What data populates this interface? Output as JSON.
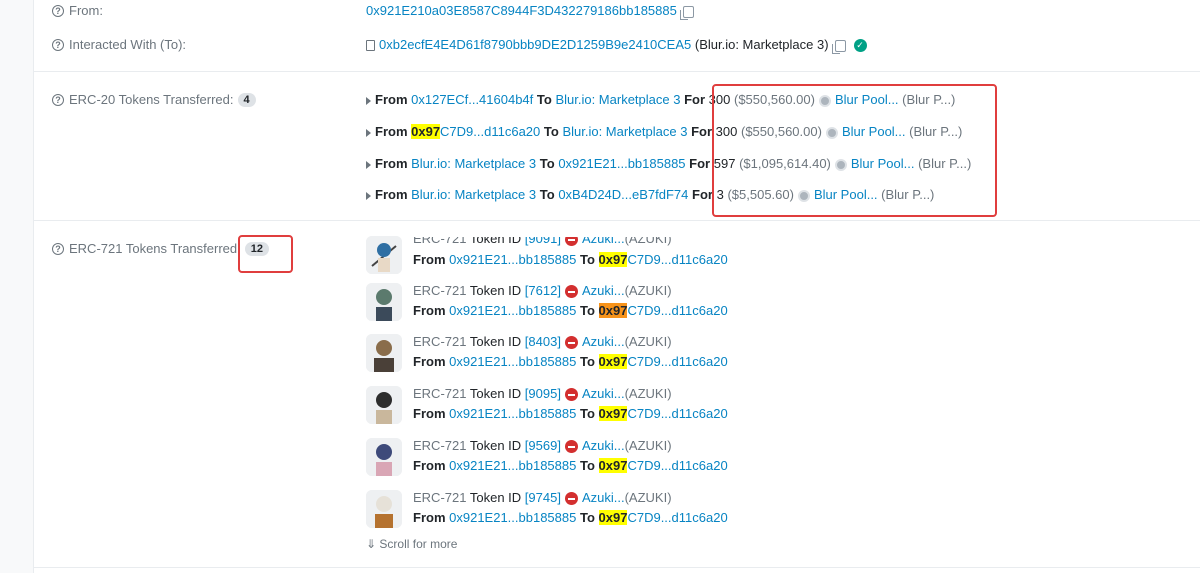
{
  "from": {
    "label": "From:",
    "address": "0x921E210a03E8587C8944F3D432279186bb185885"
  },
  "interacted": {
    "label": "Interacted With (To):",
    "address": "0xb2ecfE4E4D61f8790bbb9DE2D1259B9e2410CEA5",
    "name": "(Blur.io: Marketplace 3)"
  },
  "erc20": {
    "label": "ERC-20 Tokens Transferred:",
    "count": "4",
    "transfers": [
      {
        "from_pre": "",
        "from_hl": "",
        "from_rest": "0x127ECf...41604b4f",
        "to": "Blur.io: Marketplace 3",
        "amount": "300",
        "usd": "($550,560.00)",
        "token": "Blur Pool...",
        "symbol": "(Blur P...)"
      },
      {
        "from_pre": "",
        "from_hl": "0x97",
        "from_rest": "C7D9...d11c6a20",
        "to": "Blur.io: Marketplace 3",
        "amount": "300",
        "usd": "($550,560.00)",
        "token": "Blur Pool...",
        "symbol": "(Blur P...)"
      },
      {
        "from_pre": "",
        "from_hl": "",
        "from_rest": "Blur.io: Marketplace 3",
        "to": "0x921E21...bb185885",
        "amount": "597",
        "usd": "($1,095,614.40)",
        "token": "Blur Pool...",
        "symbol": "(Blur P...)"
      },
      {
        "from_pre": "",
        "from_hl": "",
        "from_rest": "Blur.io: Marketplace 3",
        "to": "0xB4D24D...eB7fdF74",
        "amount": "3",
        "usd": "($5,505.60)",
        "token": "Blur Pool...",
        "symbol": "(Blur P...)"
      }
    ]
  },
  "erc721": {
    "label": "ERC-721 Tokens Transferred:",
    "count": "12",
    "token_prefix": "ERC-721",
    "token_id_label": "Token ID",
    "collection": "Azuki...",
    "symbol": "(AZUKI)",
    "from_word": "From",
    "to_word": "To",
    "from_addr": "0x921E21...bb185885",
    "to_hl": "0x97",
    "to_rest": "C7D9...d11c6a20",
    "items": [
      {
        "id": "[9091]"
      },
      {
        "id": "[7612]"
      },
      {
        "id": "[8403]"
      },
      {
        "id": "[9095]"
      },
      {
        "id": "[9569]"
      },
      {
        "id": "[9745]"
      }
    ],
    "scroll_more": "Scroll for more"
  },
  "words": {
    "from": "From",
    "to": "To",
    "for": "For"
  },
  "colors": {
    "link": "#0784c3",
    "highlight_yellow": "#ffff00",
    "highlight_orange": "#f7931a",
    "annotation_red": "#e03e3e",
    "verified_green": "#00a186"
  }
}
